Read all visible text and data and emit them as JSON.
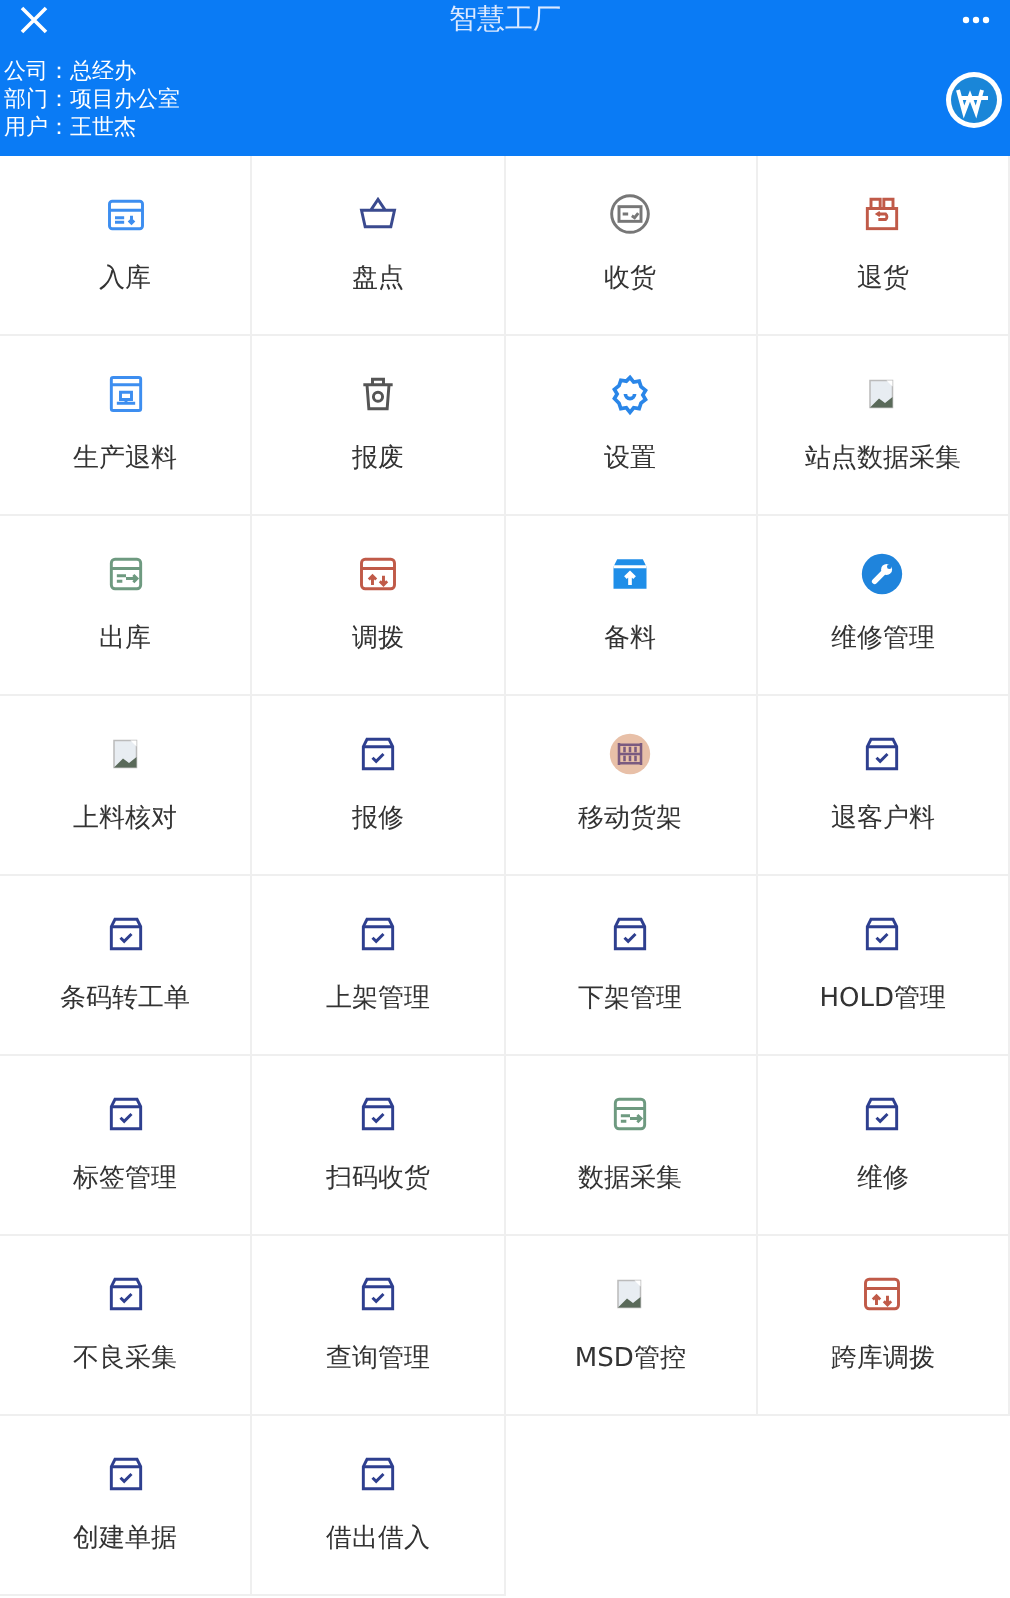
{
  "title": "智慧工厂",
  "info": [
    "公司：总经办",
    "部门：项目办公室",
    "用户：王世杰"
  ],
  "items": [
    {
      "label": "入库",
      "kind": "inbox"
    },
    {
      "label": "盘点",
      "kind": "basket"
    },
    {
      "label": "收货",
      "kind": "receipt"
    },
    {
      "label": "退货",
      "kind": "return"
    },
    {
      "label": "生产退料",
      "kind": "production"
    },
    {
      "label": "报废",
      "kind": "trash"
    },
    {
      "label": "设置",
      "kind": "gear"
    },
    {
      "label": "站点数据采集",
      "kind": "broken"
    },
    {
      "label": "出库",
      "kind": "outbox"
    },
    {
      "label": "调拨",
      "kind": "transfer"
    },
    {
      "label": "备料",
      "kind": "upload"
    },
    {
      "label": "维修管理",
      "kind": "wrench"
    },
    {
      "label": "上料核对",
      "kind": "broken"
    },
    {
      "label": "报修",
      "kind": "check"
    },
    {
      "label": "移动货架",
      "kind": "shelf"
    },
    {
      "label": "退客户料",
      "kind": "check"
    },
    {
      "label": "条码转工单",
      "kind": "check"
    },
    {
      "label": "上架管理",
      "kind": "check"
    },
    {
      "label": "下架管理",
      "kind": "check"
    },
    {
      "label": "HOLD管理",
      "kind": "check"
    },
    {
      "label": "标签管理",
      "kind": "check"
    },
    {
      "label": "扫码收货",
      "kind": "check"
    },
    {
      "label": "数据采集",
      "kind": "outbox"
    },
    {
      "label": "维修",
      "kind": "check"
    },
    {
      "label": "不良采集",
      "kind": "check"
    },
    {
      "label": "查询管理",
      "kind": "check"
    },
    {
      "label": "MSD管控",
      "kind": "broken"
    },
    {
      "label": "跨库调拨",
      "kind": "transfer"
    },
    {
      "label": "创建单据",
      "kind": "check"
    },
    {
      "label": "借出借入",
      "kind": "check"
    }
  ]
}
